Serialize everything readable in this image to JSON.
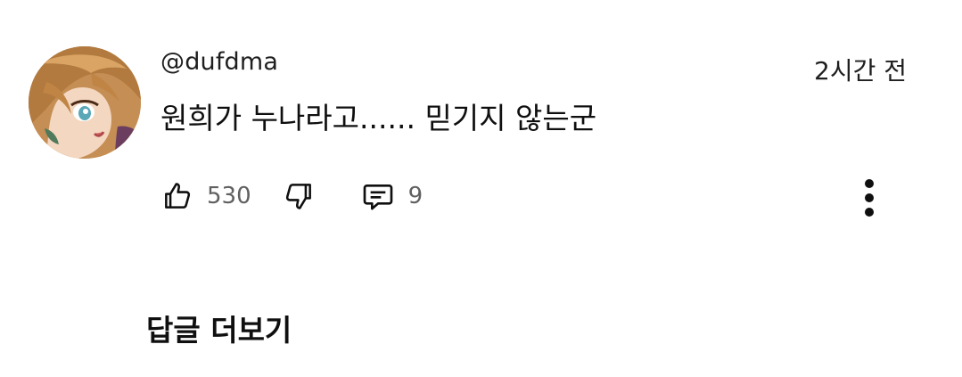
{
  "comment": {
    "avatar": "anime-character-avatar",
    "username": "@dufdma",
    "timestamp": "2시간 전",
    "text": "원희가 누나라고...... 믿기지 않는군",
    "like_count": "530",
    "reply_count": "9",
    "icons": {
      "like": "thumbs-up-icon",
      "dislike": "thumbs-down-icon",
      "reply": "comment-icon",
      "more": "more-vert-icon"
    }
  },
  "replies": {
    "more_label": "답글 더보기"
  },
  "colors": {
    "text": "#0f0f0f",
    "secondary": "#606060",
    "background": "#ffffff"
  }
}
